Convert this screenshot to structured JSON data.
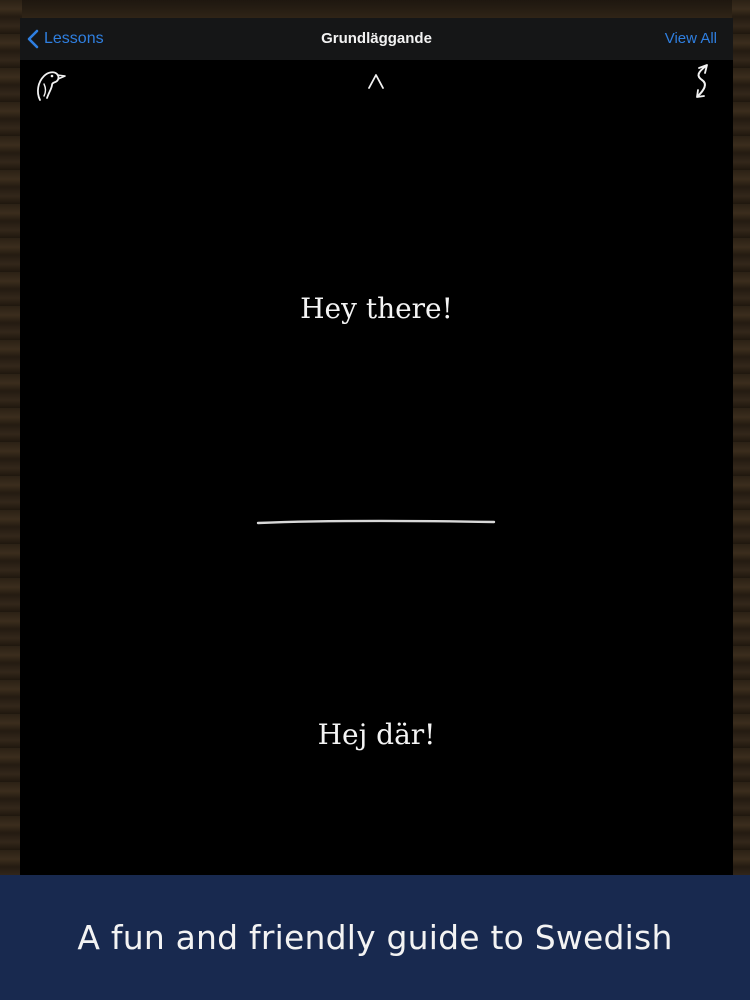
{
  "navbar": {
    "back_label": "Lessons",
    "title": "Grundläggande",
    "view_all_label": "View All"
  },
  "toolbar": {
    "left_icon": "bird-icon",
    "center_icon": "chevron-up-icon",
    "right_icon": "swap-icon"
  },
  "card": {
    "english_phrase": "Hey there!",
    "swedish_phrase": "Hej där!"
  },
  "banner": {
    "text": "A fun and friendly guide to Swedish"
  },
  "colors": {
    "accent": "#2f7fe0",
    "card_background": "#000000",
    "navbar_background": "#151617",
    "banner_background": "#18294f",
    "text": "#f4f4f4"
  }
}
